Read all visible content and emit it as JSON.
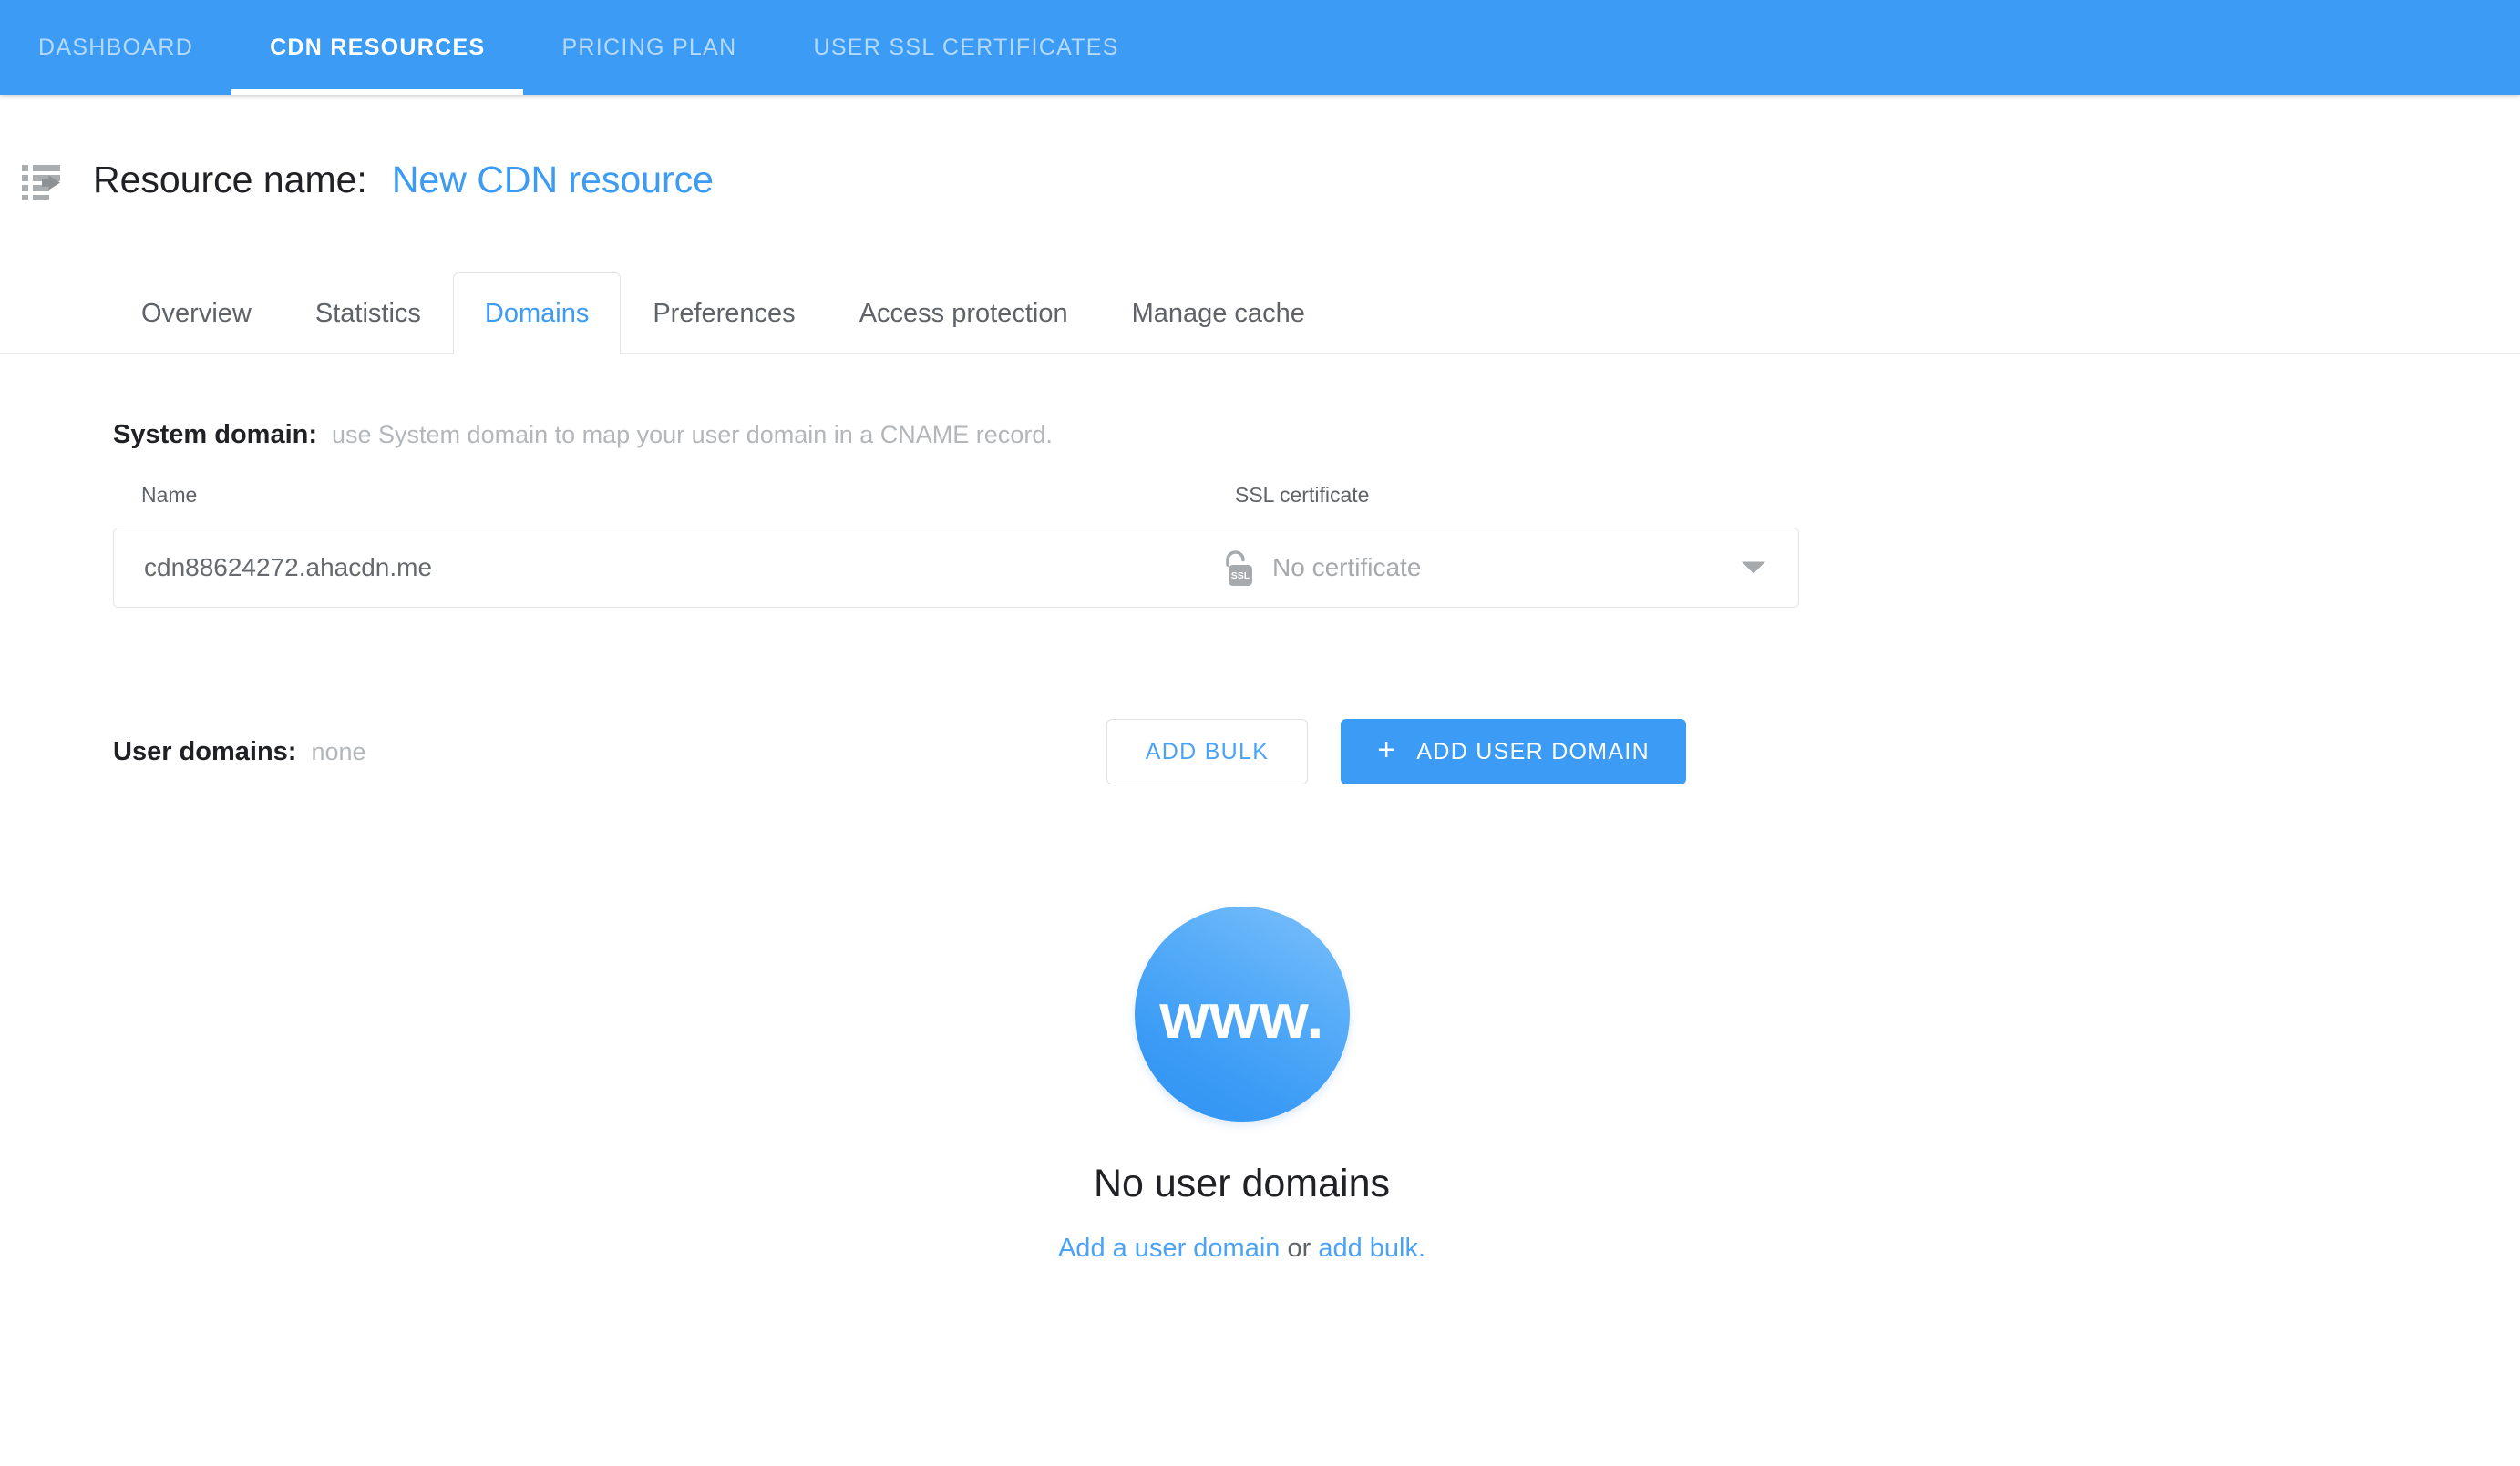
{
  "topnav": {
    "items": [
      {
        "label": "DASHBOARD",
        "active": false
      },
      {
        "label": "CDN RESOURCES",
        "active": true
      },
      {
        "label": "PRICING PLAN",
        "active": false
      },
      {
        "label": "USER SSL CERTIFICATES",
        "active": false
      }
    ]
  },
  "header": {
    "back_icon": "list-back-icon",
    "label": "Resource name:",
    "value": "New CDN resource"
  },
  "subtabs": {
    "items": [
      {
        "label": "Overview",
        "active": false
      },
      {
        "label": "Statistics",
        "active": false
      },
      {
        "label": "Domains",
        "active": true
      },
      {
        "label": "Preferences",
        "active": false
      },
      {
        "label": "Access protection",
        "active": false
      },
      {
        "label": "Manage cache",
        "active": false
      }
    ]
  },
  "system_domain": {
    "title": "System domain:",
    "note": "use System domain to map your user domain in a CNAME record.",
    "columns": {
      "name": "Name",
      "ssl": "SSL certificate"
    },
    "rows": [
      {
        "name": "cdn88624272.ahacdn.me",
        "ssl_icon": "open-padlock-ssl-icon",
        "ssl_icon_label": "SSL",
        "ssl_value": "No certificate"
      }
    ]
  },
  "user_domains": {
    "title": "User domains:",
    "value": "none",
    "add_bulk_label": "ADD BULK",
    "add_user_domain_label": "ADD USER DOMAIN",
    "add_user_domain_icon": "plus-icon"
  },
  "empty_state": {
    "badge_icon": "www-globe-icon",
    "badge_text": "www.",
    "title": "No user domains",
    "link_add_domain": "Add a user domain",
    "separator": " or ",
    "link_add_bulk": "add bulk.",
    "trailing": ""
  },
  "colors": {
    "accent_blue": "#3b9bf5",
    "link_blue": "#4aa3f7",
    "text_primary": "#202124",
    "text_secondary": "#5f6368",
    "text_muted": "#b4b7ba",
    "border": "#e2e4e7"
  }
}
